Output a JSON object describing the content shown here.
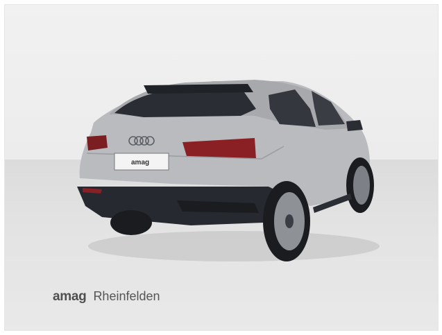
{
  "photo": {
    "subject": "car-rear-three-quarter-view",
    "body_color": "#b7b9bd",
    "plate_text": "amag"
  },
  "dealer": {
    "brand": "amag",
    "location": "Rheinfelden"
  }
}
